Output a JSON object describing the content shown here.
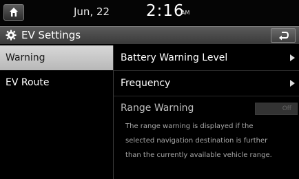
{
  "status": {
    "date": "Jun, 22",
    "time": "2:16",
    "ampm": "AM"
  },
  "header": {
    "title": "EV Settings",
    "home_icon": "home-icon",
    "settings_icon": "gear-icon",
    "back_icon": "back-arrow-icon"
  },
  "nav": {
    "items": [
      {
        "label": "Warning",
        "active": true
      },
      {
        "label": "EV Route",
        "active": false
      }
    ]
  },
  "content": {
    "rows": [
      {
        "label": "Battery Warning Level"
      },
      {
        "label": "Frequency"
      }
    ],
    "range_warning": {
      "label": "Range Warning",
      "toggle_value": "Off"
    },
    "description_lines": [
      "The range warning is displayed if the",
      "selected navigation destination is further",
      "than the currently available vehicle range."
    ]
  },
  "colors": {
    "active_tab_bg": "#c8c8c8",
    "titlebar_bg": "#4a4a4a",
    "background": "#000000"
  }
}
